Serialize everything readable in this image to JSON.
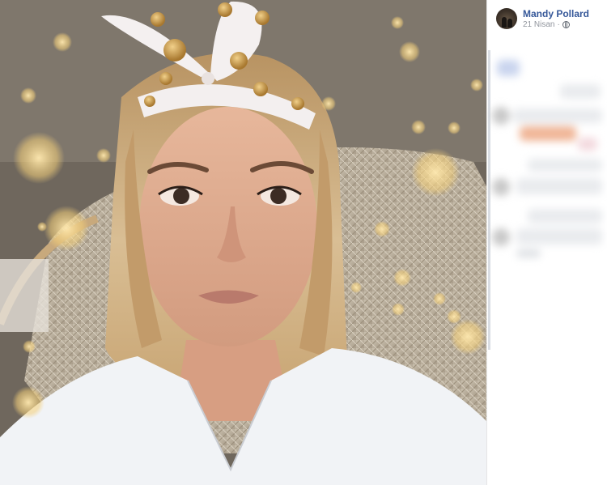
{
  "post": {
    "author_name": "Mandy Pollard",
    "date": "21 Nisan",
    "separator": "·",
    "privacy_icon": "globe-icon"
  },
  "photo": {
    "description_icon": "photo-selfie-image"
  }
}
